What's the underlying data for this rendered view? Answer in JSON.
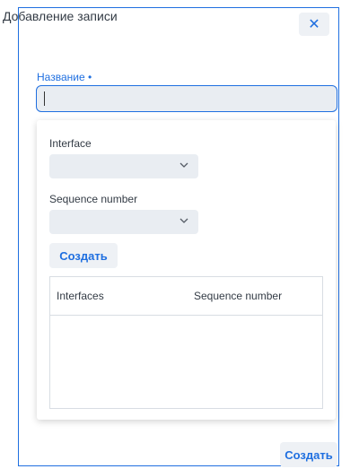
{
  "dialog": {
    "title": "Добавление записи",
    "close_icon": "close-icon",
    "close_glyph": "✕"
  },
  "name_field": {
    "label": "Название",
    "required_marker": "•",
    "value": ""
  },
  "inner_form": {
    "interface": {
      "label": "Interface",
      "value": ""
    },
    "sequence_number": {
      "label": "Sequence number",
      "value": ""
    },
    "create_label": "Создать",
    "table": {
      "columns": [
        "Interfaces",
        "Sequence number"
      ],
      "rows": []
    }
  },
  "footer": {
    "create_label": "Создать"
  },
  "colors": {
    "accent": "#1f6fe0",
    "field_bg": "#e9edf2",
    "button_bg": "#eef1f5",
    "text": "#333b45"
  }
}
